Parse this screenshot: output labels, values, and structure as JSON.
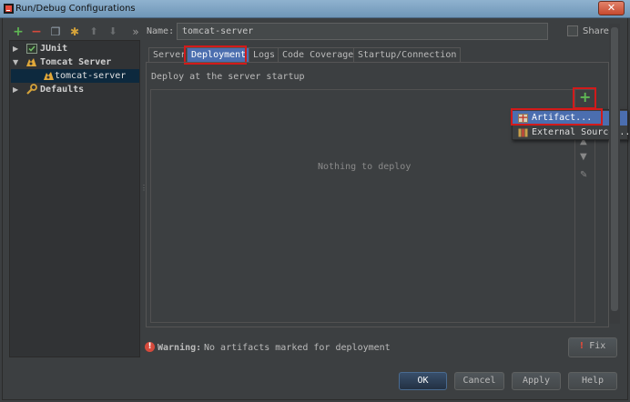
{
  "window": {
    "title": "Run/Debug Configurations",
    "close_glyph": "✕"
  },
  "toolbar": {
    "add_glyph": "+",
    "remove_glyph": "−",
    "copy_glyph": "❐",
    "settings_glyph": "✱",
    "up_glyph": "⬆",
    "down_glyph": "⬇",
    "more_glyph": "»"
  },
  "tree": {
    "items": [
      {
        "label": "JUnit",
        "expanded": false
      },
      {
        "label": "Tomcat Server",
        "expanded": true
      },
      {
        "label": "tomcat-server",
        "selected": true
      },
      {
        "label": "Defaults",
        "expanded": false
      }
    ],
    "arrow_collapsed": "▶",
    "arrow_expanded": "▼"
  },
  "name_field": {
    "label": "Name:",
    "value": "tomcat-server"
  },
  "share": {
    "label": "Share",
    "checked": false
  },
  "tabs": [
    {
      "label": "Server",
      "active": false
    },
    {
      "label": "Deployment",
      "active": true
    },
    {
      "label": "Logs",
      "active": false
    },
    {
      "label": "Code Coverage",
      "active": false
    },
    {
      "label": "Startup/Connection",
      "active": false
    }
  ],
  "deployment": {
    "section_label": "Deploy at the server startup",
    "empty_text": "Nothing to deploy",
    "add_glyph": "+",
    "side_icons": [
      "▲",
      "▼",
      "✎"
    ]
  },
  "popup": {
    "items": [
      {
        "label": "Artifact...",
        "selected": true
      },
      {
        "label": "External Source...",
        "selected": false
      }
    ]
  },
  "warning": {
    "icon_glyph": "!",
    "bold": "Warning:",
    "text": "No artifacts marked for deployment"
  },
  "buttons": {
    "fix": "Fix",
    "fix_glyph": "!",
    "ok": "OK",
    "cancel": "Cancel",
    "apply": "Apply",
    "help": "Help"
  },
  "colors": {
    "background": "#3c3f41",
    "tree_background": "#313335",
    "selection": "#4b6eaf",
    "highlight_box": "#d21a1a",
    "add_green": "#5fb854",
    "warning_red": "#d64a3c"
  }
}
